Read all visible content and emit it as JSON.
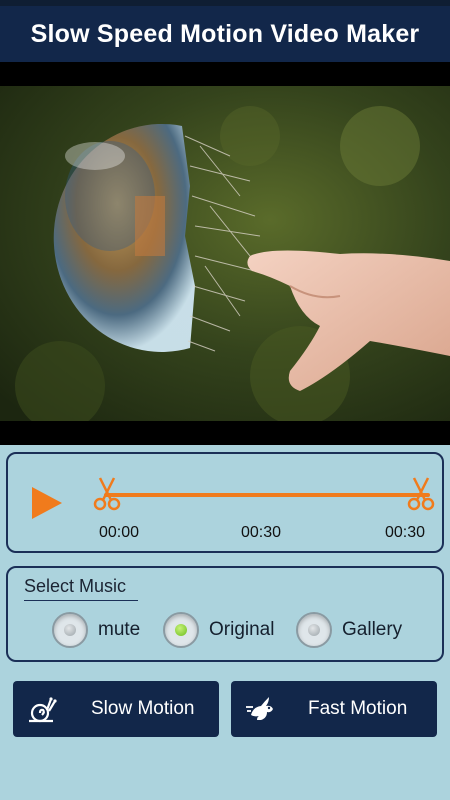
{
  "app": {
    "title": "Slow Speed Motion Video Maker"
  },
  "video": {
    "description_icon": "video-preview"
  },
  "trim": {
    "start_time": "00:00",
    "mid_time": "00:30",
    "end_time": "00:30",
    "accent_color": "#f07b1c"
  },
  "music": {
    "label": "Select Music",
    "options": [
      {
        "label": "mute",
        "selected": false
      },
      {
        "label": "Original",
        "selected": true
      },
      {
        "label": "Gallery",
        "selected": false
      }
    ]
  },
  "actions": {
    "slow_label": "Slow Motion",
    "fast_label": "Fast Motion",
    "slow_icon": "snail-icon",
    "fast_icon": "rabbit-icon"
  },
  "colors": {
    "primary": "#12274a",
    "background": "#acd3dd",
    "accent": "#f07b1c"
  }
}
